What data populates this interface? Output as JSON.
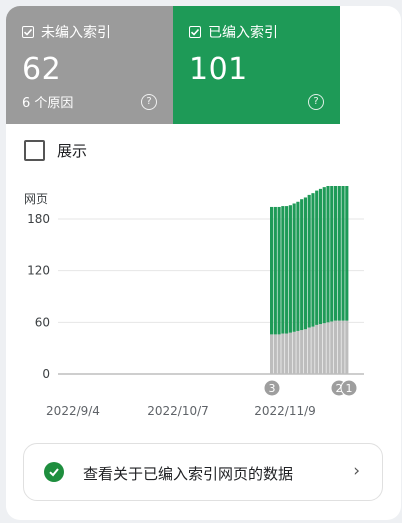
{
  "tiles": {
    "unindexed": {
      "label": "未编入索引",
      "value": "62",
      "sub": "6 个原因",
      "help": "?"
    },
    "indexed": {
      "label": "已编入索引",
      "value": "101",
      "help": "?"
    }
  },
  "show": {
    "label": "展示"
  },
  "chart_data": {
    "type": "bar",
    "ylabel": "网页",
    "ylim": [
      0,
      180
    ],
    "yticks": [
      "180",
      "120",
      "60",
      "0"
    ],
    "xticks": [
      "2022/9/4",
      "2022/10/7",
      "2022/11/9"
    ],
    "series": [
      {
        "color": "#bdbdbd",
        "values": [
          46,
          46,
          46,
          47,
          47,
          48,
          49,
          50,
          51,
          52,
          54,
          55,
          57,
          58,
          59,
          60,
          61,
          62,
          62,
          62,
          62
        ]
      },
      {
        "color": "#1e9a57",
        "values": [
          148,
          148,
          148,
          148,
          148,
          148,
          149,
          150,
          152,
          153,
          154,
          155,
          156,
          157,
          158,
          159,
          160,
          161,
          162,
          163,
          163
        ]
      }
    ],
    "annotations": [
      "3",
      "2",
      "1"
    ]
  },
  "colors": {
    "indexed": "#1e9a57",
    "unindexed": "#9b9b9b"
  },
  "link": {
    "label": "查看关于已编入索引网页的数据",
    "chevron": "›",
    "icon": "check-circle-icon"
  }
}
